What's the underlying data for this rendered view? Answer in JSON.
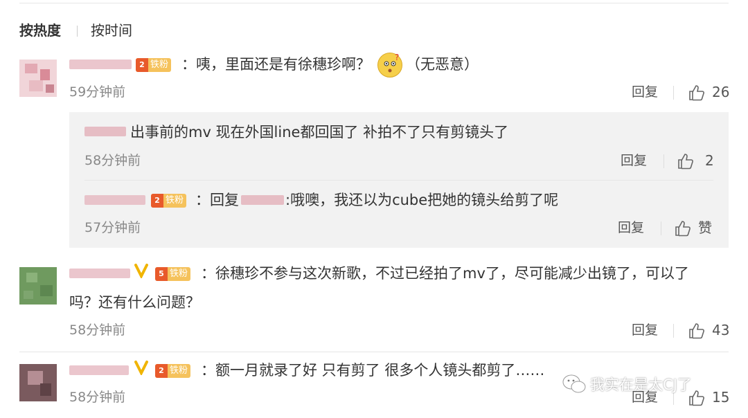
{
  "sort_tabs": {
    "hot": "按热度",
    "time": "按时间"
  },
  "badge_label": "铁粉",
  "actions": {
    "reply": "回复"
  },
  "comments": [
    {
      "text": "：咦，里面还是有徐穗珍啊？",
      "suffix": "（无恶意）",
      "time": "59分钟前",
      "likes": "26",
      "badge_level": "2",
      "replies": [
        {
          "text": "出事前的mv 现在外国line都回国了 补拍不了只有剪镜头了",
          "time": "58分钟前",
          "likes": "2"
        },
        {
          "prefix": "：回复",
          "text": ":哦噢，我还以为cube把她的镜头给剪了呢",
          "time": "57分钟前",
          "likes": "赞",
          "badge_level": "2"
        }
      ]
    },
    {
      "text_line1": "：徐穗珍不参与这次新歌，不过已经拍了mv了，尽可能减少出镜了，可以了",
      "text_line2": "吗？还有什么问题？",
      "time": "58分钟前",
      "likes": "43",
      "badge_level": "5"
    },
    {
      "text": "：额一月就录了好 只有剪了 很多个人镜头都剪了……",
      "time": "58分钟前",
      "likes": "15",
      "badge_level": "2"
    }
  ],
  "watermark": "我实在是太CJ了",
  "colors": {
    "badge_bg": "#f5c25c",
    "badge_icon": "#e85a2b",
    "reply_bg": "#f2f2f2"
  }
}
